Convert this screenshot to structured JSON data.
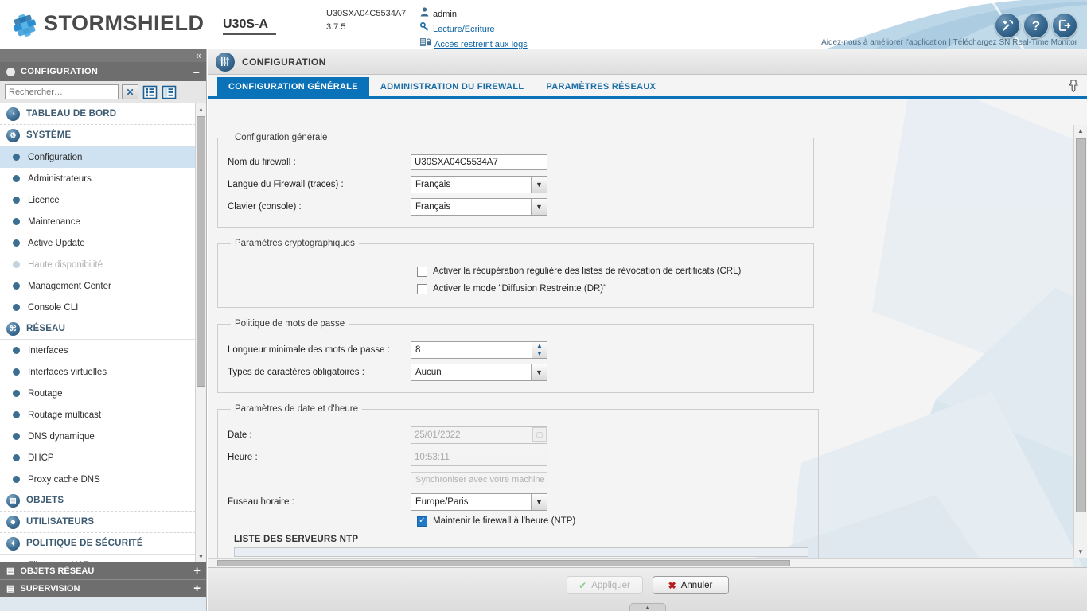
{
  "header": {
    "brand": "STORMSHIELD",
    "model": "U30S-A",
    "serial": "U30SXA04C5534A7",
    "version": "3.7.5",
    "user": "admin",
    "rights_link": "Lecture/Ecriture",
    "logs_link": "Accès restreint aux logs",
    "icons": {
      "tools": "tools-icon",
      "help": "help-icon",
      "logout": "logout-icon"
    },
    "footer_note": "Aidez-nous à améliorer l'application",
    "footer_sep": "|",
    "footer_link": "Téléchargez SN Real-Time Monitor"
  },
  "sidebar": {
    "panel_title": "CONFIGURATION",
    "search": {
      "placeholder": "Rechercher…",
      "value": "",
      "clear_label": "✕"
    },
    "groups": [
      {
        "label": "TABLEAU DE BORD",
        "icon": "dashboard-icon",
        "items": []
      },
      {
        "label": "SYSTÈME",
        "icon": "system-icon",
        "items": [
          {
            "label": "Configuration",
            "selected": true,
            "disabled": false
          },
          {
            "label": "Administrateurs",
            "selected": false,
            "disabled": false
          },
          {
            "label": "Licence",
            "selected": false,
            "disabled": false
          },
          {
            "label": "Maintenance",
            "selected": false,
            "disabled": false
          },
          {
            "label": "Active Update",
            "selected": false,
            "disabled": false
          },
          {
            "label": "Haute disponibilité",
            "selected": false,
            "disabled": true
          },
          {
            "label": "Management Center",
            "selected": false,
            "disabled": false
          },
          {
            "label": "Console CLI",
            "selected": false,
            "disabled": false
          }
        ]
      },
      {
        "label": "RÉSEAU",
        "icon": "network-icon",
        "items": [
          {
            "label": "Interfaces",
            "selected": false,
            "disabled": false
          },
          {
            "label": "Interfaces virtuelles",
            "selected": false,
            "disabled": false
          },
          {
            "label": "Routage",
            "selected": false,
            "disabled": false
          },
          {
            "label": "Routage multicast",
            "selected": false,
            "disabled": false
          },
          {
            "label": "DNS dynamique",
            "selected": false,
            "disabled": false
          },
          {
            "label": "DHCP",
            "selected": false,
            "disabled": false
          },
          {
            "label": "Proxy cache DNS",
            "selected": false,
            "disabled": false
          }
        ]
      },
      {
        "label": "OBJETS",
        "icon": "objects-icon",
        "items": []
      },
      {
        "label": "UTILISATEURS",
        "icon": "users-icon",
        "items": []
      },
      {
        "label": "POLITIQUE DE SÉCURITÉ",
        "icon": "shield-icon",
        "items": [
          {
            "label": "Filtrage et NAT",
            "selected": false,
            "disabled": false
          }
        ]
      }
    ],
    "bottom_panels": [
      {
        "label": "OBJETS RÉSEAU",
        "icon": "objects-icon",
        "expand": "+"
      },
      {
        "label": "SUPERVISION",
        "icon": "chart-icon",
        "expand": "+"
      }
    ]
  },
  "main": {
    "page_title": "CONFIGURATION",
    "tabs": [
      {
        "label": "CONFIGURATION GÉNÉRALE",
        "active": true
      },
      {
        "label": "ADMINISTRATION DU FIREWALL",
        "active": false
      },
      {
        "label": "PARAMÈTRES RÉSEAUX",
        "active": false
      }
    ],
    "general": {
      "legend": "Configuration générale",
      "firewall_name_label": "Nom du firewall :",
      "firewall_name_value": "U30SXA04C5534A7",
      "language_label": "Langue du Firewall (traces) :",
      "language_value": "Français",
      "keyboard_label": "Clavier (console) :",
      "keyboard_value": "Français"
    },
    "crypto": {
      "legend": "Paramètres cryptographiques",
      "crl_label": "Activer la récupération régulière des listes de révocation de certificats (CRL)",
      "crl_checked": false,
      "dr_label": "Activer le mode \"Diffusion Restreinte (DR)\"",
      "dr_checked": false
    },
    "password": {
      "legend": "Politique de mots de passe",
      "minlen_label": "Longueur minimale des mots de passe :",
      "minlen_value": "8",
      "chartypes_label": "Types de caractères obligatoires :",
      "chartypes_value": "Aucun"
    },
    "datetime": {
      "legend": "Paramètres de date et d'heure",
      "date_label": "Date :",
      "date_value": "25/01/2022",
      "time_label": "Heure :",
      "time_value": "10:53:11",
      "sync_button": "Synchroniser avec votre machine",
      "timezone_label": "Fuseau horaire :",
      "timezone_value": "Europe/Paris",
      "ntp_label": "Maintenir le firewall à l'heure (NTP)",
      "ntp_checked": true,
      "ntp_list_title": "LISTE DES SERVEURS NTP"
    },
    "footer": {
      "apply_label": "Appliquer",
      "apply_disabled": true,
      "cancel_label": "Annuler"
    }
  },
  "colors": {
    "accent_blue": "#0a72b8",
    "panel_gray": "#6e6e6e",
    "selected_row": "#cfe2f1",
    "link_blue": "#0b62a4"
  }
}
